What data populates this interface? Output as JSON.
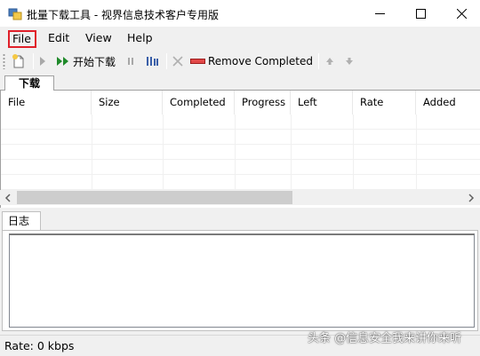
{
  "window": {
    "title": "批量下载工具 - 视界信息技术客户专用版",
    "minimize_icon": "minimize-icon",
    "maximize_icon": "maximize-icon",
    "close_icon": "close-icon"
  },
  "menu": {
    "file": "File",
    "edit": "Edit",
    "view": "View",
    "help": "Help",
    "highlight_color": "#e0202a"
  },
  "toolbar": {
    "start_download": "开始下载",
    "remove_completed": "Remove Completed"
  },
  "tabs": {
    "download": "下载"
  },
  "grid": {
    "columns": [
      "File",
      "Size",
      "Completed",
      "Progress",
      "Left",
      "Rate",
      "Added"
    ]
  },
  "log": {
    "tab_label": "日志"
  },
  "status": {
    "rate": "Rate:  0 kbps"
  },
  "watermark": "头条 @信息安全我来讲你来听"
}
